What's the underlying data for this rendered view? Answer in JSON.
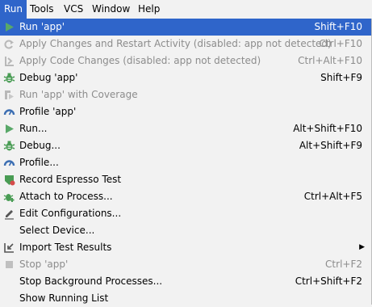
{
  "menubar": {
    "items": [
      "Run",
      "Tools",
      "VCS",
      "Window",
      "Help"
    ],
    "active": "Run"
  },
  "menu": {
    "items": [
      {
        "label": "Run 'app'",
        "shortcut": "Shift+F10",
        "icon": "run-triangle-icon",
        "state": "selected"
      },
      {
        "label": "Apply Changes and Restart Activity (disabled: app not detected)",
        "shortcut": "Ctrl+F10",
        "icon": "apply-changes-restart-icon",
        "state": "disabled"
      },
      {
        "label": "Apply Code Changes (disabled: app not detected)",
        "shortcut": "Ctrl+Alt+F10",
        "icon": "apply-code-changes-icon",
        "state": "disabled"
      },
      {
        "label": "Debug 'app'",
        "shortcut": "Shift+F9",
        "icon": "debug-bug-icon",
        "state": "normal"
      },
      {
        "label": "Run 'app' with Coverage",
        "shortcut": "",
        "icon": "coverage-icon",
        "state": "disabled"
      },
      {
        "label": "Profile 'app'",
        "shortcut": "",
        "icon": "profile-gauge-icon",
        "state": "normal"
      },
      {
        "label": "Run...",
        "shortcut": "Alt+Shift+F10",
        "icon": "run-triangle-icon",
        "state": "normal"
      },
      {
        "label": "Debug...",
        "shortcut": "Alt+Shift+F9",
        "icon": "debug-bug-icon",
        "state": "normal"
      },
      {
        "label": "Profile...",
        "shortcut": "",
        "icon": "profile-gauge-icon",
        "state": "normal"
      },
      {
        "label": "Record Espresso Test",
        "shortcut": "",
        "icon": "record-espresso-icon",
        "state": "normal"
      },
      {
        "label": "Attach to Process...",
        "shortcut": "Ctrl+Alt+F5",
        "icon": "attach-debugger-icon",
        "state": "normal"
      },
      {
        "label": "Edit Configurations...",
        "shortcut": "",
        "icon": "edit-pencil-icon",
        "state": "normal"
      },
      {
        "label": "Select Device...",
        "shortcut": "",
        "icon": "",
        "state": "normal"
      },
      {
        "label": "Import Test Results",
        "shortcut": "",
        "icon": "import-test-results-icon",
        "state": "normal",
        "submenu": true
      },
      {
        "label": "Stop 'app'",
        "shortcut": "Ctrl+F2",
        "icon": "stop-square-icon",
        "state": "disabled"
      },
      {
        "label": "Stop Background Processes...",
        "shortcut": "Ctrl+Shift+F2",
        "icon": "",
        "state": "normal"
      },
      {
        "label": "Show Running List",
        "shortcut": "",
        "icon": "",
        "state": "normal"
      }
    ]
  },
  "colors": {
    "selection": "#2f65ca",
    "run_green": "#59a869",
    "debug_green": "#499c54",
    "profile_blue": "#3d6fb3",
    "disabled_text": "#8c8c8c",
    "menu_background": "#f2f2f2"
  }
}
